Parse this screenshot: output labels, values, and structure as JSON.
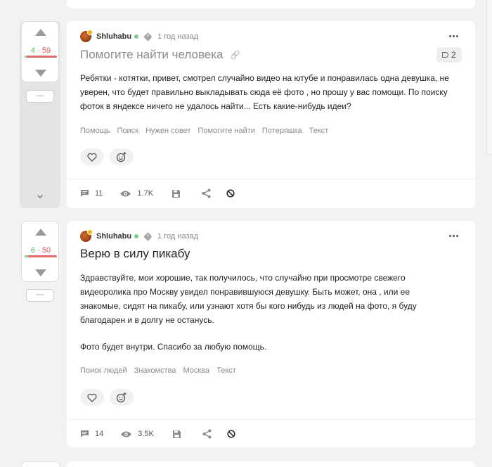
{
  "stories": [
    {
      "author": "Shluhabu",
      "time": "1 год назад",
      "title": "Помогите найти человека",
      "title_muted": true,
      "comments_badge": "2",
      "text": "Ребятки - котятки, привет, смотрел случайно видео на ютубе и понравилась одна девушка, не уверен, что будет правильно выкладывать сюда её фото , но прошу у вас помощи. По поиску фоток в яндексе ничего не удалось найти... Есть какие-нибудь идеи?",
      "tags": [
        "Помощь",
        "Поиск",
        "Нужен совет",
        "Помогите найти",
        "Потеряшка",
        "Текст"
      ],
      "rating": {
        "plus": "4",
        "sep": " - ",
        "minus": "59",
        "plus_ratio": 0.06
      },
      "save_label": "—",
      "comments": "11",
      "views": "1.7K"
    },
    {
      "author": "Shluhabu",
      "time": "1 год назад",
      "title": "Верю в силу пикабу",
      "title_muted": false,
      "text": "Здравствуйте, мои хорошие, так получилось, что случайно при просмотре свежего видеоролика про Москву увидел понравившуюся девушку. Быть может, она , или ее знакомые, сидят на пикабу, или узнают хотя бы кого нибудь из людей на фото, я буду благодарен и в долгу не останусь.",
      "text2": "Фото будет внутри. Спасибо за любую помощь.",
      "tags": [
        "Поиск людей",
        "Знакомства",
        "Москва",
        "Текст"
      ],
      "rating": {
        "plus": "6",
        "sep": " - ",
        "minus": "50",
        "plus_ratio": 0.11
      },
      "save_label": "—",
      "comments": "14",
      "views": "3.5K"
    }
  ],
  "icons": {
    "vote_up": "arrow-up-icon",
    "vote_down": "arrow-down-icon",
    "more": "more-dots-icon",
    "tag": "tag-icon",
    "link": "link-icon",
    "comments": "comment-icon",
    "views": "eye-icon",
    "save": "floppy-icon",
    "share": "share-icon",
    "hide": "block-icon",
    "like": "heart-icon",
    "emoji": "add-emoji-icon"
  },
  "colors": {
    "plus": "#5cb85c",
    "minus": "#e05555",
    "online": "#7ccf8a"
  }
}
